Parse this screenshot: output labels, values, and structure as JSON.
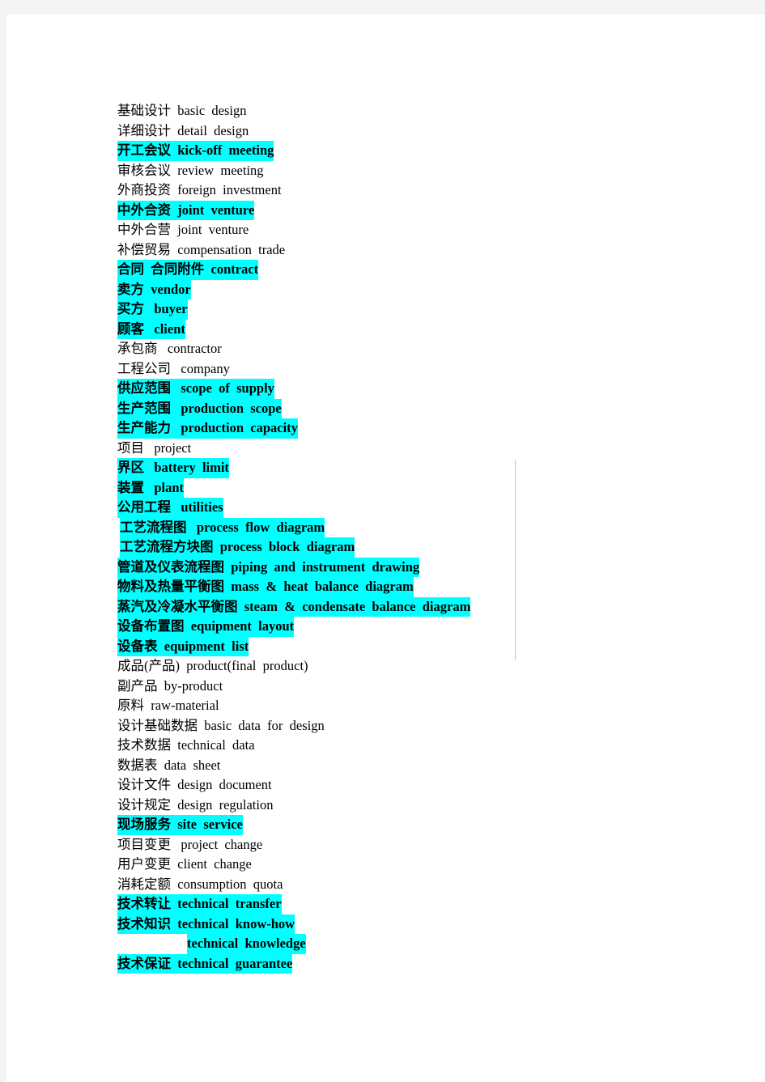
{
  "document": {
    "type": "bilingual-glossary",
    "language_pair": "Chinese-English",
    "highlight_color": "#00ffff",
    "page_background": "#ffffff",
    "backdrop_color": "#f4f4f4",
    "text_color": "#000000"
  },
  "entries": [
    {
      "zh": "基础设计",
      "en": "basic  design",
      "text": "基础设计  basic  design",
      "highlighted": false
    },
    {
      "zh": "详细设计",
      "en": "detail  design",
      "text": "详细设计  detail  design",
      "highlighted": false
    },
    {
      "zh": "开工会议",
      "en": "kick-off  meeting",
      "text": "开工会议  kick-off  meeting",
      "highlighted": true
    },
    {
      "zh": "审核会议",
      "en": "review  meeting",
      "text": "审核会议  review  meeting",
      "highlighted": false
    },
    {
      "zh": "外商投资",
      "en": "foreign  investment",
      "text": "外商投资  foreign  investment",
      "highlighted": false
    },
    {
      "zh": "中外合资",
      "en": "joint  venture",
      "text": "中外合资  joint  venture",
      "highlighted": true
    },
    {
      "zh": "中外合营",
      "en": "joint  venture",
      "text": "中外合营  joint  venture",
      "highlighted": false
    },
    {
      "zh": "补偿贸易",
      "en": "compensation  trade",
      "text": "补偿贸易  compensation  trade",
      "highlighted": false
    },
    {
      "zh": "合同  合同附件",
      "en": "contract",
      "text": "合同  合同附件  contract",
      "highlighted": true
    },
    {
      "zh": "卖方",
      "en": "vendor",
      "text": "卖方  vendor",
      "highlighted": true
    },
    {
      "zh": "买方",
      "en": "buyer",
      "text": "买方   buyer",
      "highlighted": true
    },
    {
      "zh": "顾客",
      "en": "client",
      "text": "顾客   client",
      "highlighted": true
    },
    {
      "zh": "承包商",
      "en": "contractor",
      "text": "承包商   contractor",
      "highlighted": false
    },
    {
      "zh": "工程公司",
      "en": "company",
      "text": "工程公司   company",
      "highlighted": false
    },
    {
      "zh": "供应范围",
      "en": "scope  of  supply",
      "text": "供应范围   scope  of  supply",
      "highlighted": true
    },
    {
      "zh": "生产范围",
      "en": "production  scope",
      "text": "生产范围   production  scope",
      "highlighted": true
    },
    {
      "zh": "生产能力",
      "en": "production  capacity",
      "text": "生产能力   production  capacity",
      "highlighted": true
    },
    {
      "zh": "项目",
      "en": "project",
      "text": "项目   project",
      "highlighted": false
    },
    {
      "zh": "界区",
      "en": "battery  limit",
      "text": "界区   battery  limit",
      "highlighted": true
    },
    {
      "zh": "装置",
      "en": "plant",
      "text": "装置   plant",
      "highlighted": true
    },
    {
      "zh": "公用工程",
      "en": "utilities",
      "text": "公用工程   utilities",
      "highlighted": true
    },
    {
      "zh": "工艺流程图",
      "en": "process  flow  diagram",
      "text": "工艺流程图   process  flow  diagram",
      "highlighted": true,
      "indent": true
    },
    {
      "zh": "工艺流程方块图",
      "en": "process  block  diagram",
      "text": "工艺流程方块图  process  block  diagram",
      "highlighted": true,
      "indent": true
    },
    {
      "zh": "管道及仪表流程图",
      "en": "piping  and  instrument  drawing",
      "text": "管道及仪表流程图  piping  and  instrument  drawing",
      "highlighted": true
    },
    {
      "zh": "物料及热量平衡图",
      "en": "mass  &  heat  balance  diagram",
      "text": "物料及热量平衡图  mass  &  heat  balance  diagram",
      "highlighted": true
    },
    {
      "zh": "蒸汽及冷凝水平衡图",
      "en": "steam  &  condensate  balance  diagram",
      "text": "蒸汽及冷凝水平衡图  steam  &  condensate  balance  diagram",
      "highlighted": true
    },
    {
      "zh": "设备布置图",
      "en": "equipment  layout",
      "text": "设备布置图  equipment  layout",
      "highlighted": true
    },
    {
      "zh": "设备表",
      "en": "equipment  list",
      "text": "设备表  equipment  list",
      "highlighted": true
    },
    {
      "zh": "成品(产品)",
      "en": "product(final  product)",
      "text": "成品(产品)  product(final  product)",
      "highlighted": false
    },
    {
      "zh": "副产品",
      "en": "by-product",
      "text": "副产品  by-product",
      "highlighted": false
    },
    {
      "zh": "原料",
      "en": "raw-material",
      "text": "原料  raw-material",
      "highlighted": false
    },
    {
      "zh": "设计基础数据",
      "en": "basic  data  for  design",
      "text": "设计基础数据  basic  data  for  design",
      "highlighted": false
    },
    {
      "zh": "技术数据",
      "en": "technical  data",
      "text": "技术数据  technical  data",
      "highlighted": false
    },
    {
      "zh": "数据表",
      "en": "data  sheet",
      "text": "数据表  data  sheet",
      "highlighted": false
    },
    {
      "zh": "设计文件",
      "en": "design  document",
      "text": "设计文件  design  document",
      "highlighted": false
    },
    {
      "zh": "设计规定",
      "en": "design  regulation",
      "text": "设计规定  design  regulation",
      "highlighted": false
    },
    {
      "zh": "现场服务",
      "en": "site  service",
      "text": "现场服务  site  service",
      "highlighted": true
    },
    {
      "zh": "项目变更",
      "en": "project  change",
      "text": "项目变更   project  change",
      "highlighted": false
    },
    {
      "zh": "用户变更",
      "en": "client  change",
      "text": "用户变更  client  change",
      "highlighted": false
    },
    {
      "zh": "消耗定额",
      "en": "consumption  quota",
      "text": "消耗定额  consumption  quota",
      "highlighted": false
    },
    {
      "zh": "技术转让",
      "en": "technical  transfer",
      "text": "技术转让  technical  transfer",
      "highlighted": true
    },
    {
      "zh": "技术知识",
      "en": "technical  know-how",
      "text": "技术知识  technical  know-how",
      "highlighted": true
    },
    {
      "zh": "",
      "en": "technical  knowledge",
      "text": "technical  knowledge",
      "highlighted": true,
      "continuation": true
    },
    {
      "zh": "技术保证",
      "en": "technical  guarantee",
      "text": "技术保证  technical  guarantee",
      "highlighted": true
    }
  ],
  "decorations": {
    "vertical_rule": {
      "name": "vertical-cyan-rule",
      "color": "#33ffff"
    }
  }
}
